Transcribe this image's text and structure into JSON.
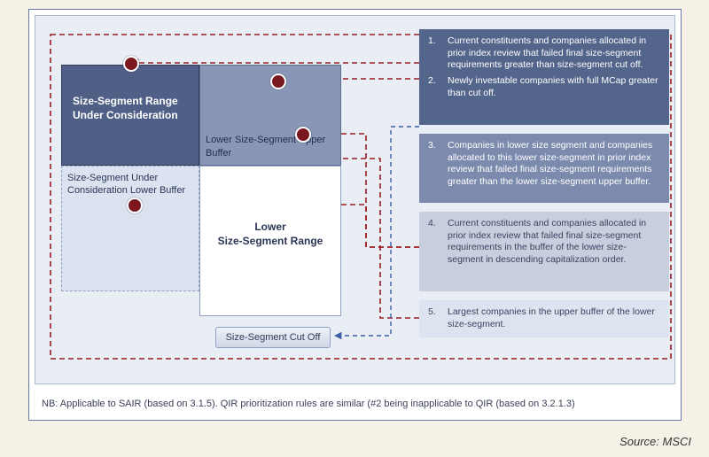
{
  "diagram": {
    "main_block": {
      "title_line1": "Size-Segment Range",
      "title_line2": "Under Consideration"
    },
    "upper_buffer": {
      "label_line1": "Lower Size-Segment Upper",
      "label_line2": "Buffer"
    },
    "lower_buffer": {
      "label_line1": "Size-Segment Under",
      "label_line2": "Consideration Lower Buffer"
    },
    "lower_range": {
      "label_line1": "Lower",
      "label_line2": "Size-Segment Range"
    },
    "cutoff_button": "Size-Segment Cut Off"
  },
  "panels": {
    "p1_num1": "1.",
    "p1_text1": "Current constituents and companies allocated in prior index review that failed final size-segment requirements greater than size-segment cut off.",
    "p1_num2": "2.",
    "p1_text2": "Newly investable companies with full MCap greater than cut off.",
    "p2_num": "3.",
    "p2_text": "Companies in lower size segment and companies allocated to this lower size-segment in prior index review that failed final size-segment requirements greater than the lower size-segment upper buffer.",
    "p3_num": "4.",
    "p3_text": "Current constituents and companies allocated in prior index review that failed final size-segment requirements in the buffer of the lower size-segment in descending capitalization order.",
    "p4_num": "5.",
    "p4_text": "Largest companies in the upper buffer of the lower size-segment."
  },
  "note_text": "NB: Applicable to SAIR (based on 3.1.5).  QIR prioritization rules are similar (#2 being inapplicable to QIR (based on 3.2.1.3)",
  "source_text": "Source: MSCI"
}
